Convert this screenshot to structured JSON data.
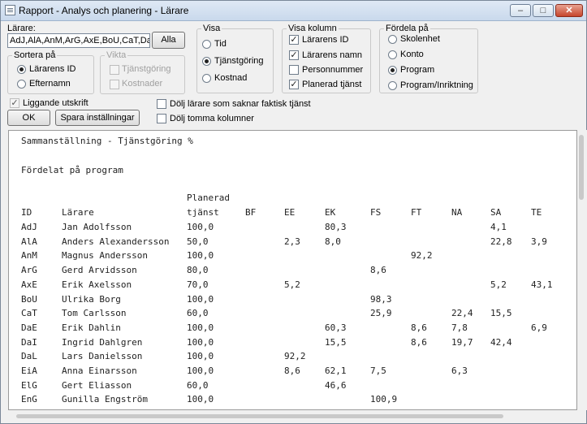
{
  "window": {
    "title": "Rapport - Analys och planering - Lärare",
    "minimize_glyph": "–",
    "maximize_glyph": "□",
    "close_glyph": "✕"
  },
  "larare": {
    "label": "Lärare:",
    "value": "AdJ,AlA,AnM,ArG,AxE,BoU,CaT,DaE,Da",
    "all_button": "Alla"
  },
  "sortera": {
    "title": "Sortera på",
    "options": [
      {
        "label": "Lärarens ID",
        "selected": true
      },
      {
        "label": "Efternamn",
        "selected": false
      }
    ]
  },
  "vikta": {
    "title": "Vikta",
    "options": [
      {
        "label": "Tjänstgöring",
        "checked": false
      },
      {
        "label": "Kostnader",
        "checked": false
      }
    ]
  },
  "visa": {
    "title": "Visa",
    "options": [
      {
        "label": "Tid",
        "selected": false
      },
      {
        "label": "Tjänstgöring",
        "selected": true
      },
      {
        "label": "Kostnad",
        "selected": false
      }
    ]
  },
  "visa_kolumn": {
    "title": "Visa kolumn",
    "options": [
      {
        "label": "Lärarens ID",
        "checked": true
      },
      {
        "label": "Lärarens namn",
        "checked": true
      },
      {
        "label": "Personnummer",
        "checked": false
      },
      {
        "label": "Planerad tjänst",
        "checked": true
      }
    ]
  },
  "fordela": {
    "title": "Fördela på",
    "options": [
      {
        "label": "Skolenhet",
        "selected": false
      },
      {
        "label": "Konto",
        "selected": false
      },
      {
        "label": "Program",
        "selected": true
      },
      {
        "label": "Program/Inriktning",
        "selected": false
      }
    ]
  },
  "options": {
    "liggande": {
      "label": "Liggande utskrift",
      "checked": true
    },
    "dolj_larare": {
      "label": "Dölj lärare som saknar faktisk tjänst",
      "checked": false
    },
    "dolj_tomma": {
      "label": "Dölj tomma kolumner",
      "checked": false
    }
  },
  "buttons": {
    "ok": "OK",
    "save": "Spara inställningar"
  },
  "report": {
    "title": "Sammanställning - Tjänstgöring %",
    "subtitle": "Fördelat på program",
    "header_top": "Planerad",
    "columns": [
      "ID",
      "Lärare",
      "tjänst",
      "BF",
      "EE",
      "EK",
      "FS",
      "FT",
      "NA",
      "SA",
      "TE"
    ],
    "rows": [
      [
        "AdJ",
        "Jan Adolfsson",
        "100,0",
        "",
        "",
        "80,3",
        "",
        "",
        "",
        "4,1",
        ""
      ],
      [
        "AlA",
        "Anders Alexandersson",
        "50,0",
        "",
        "2,3",
        "8,0",
        "",
        "",
        "",
        "22,8",
        "3,9"
      ],
      [
        "AnM",
        "Magnus Andersson",
        "100,0",
        "",
        "",
        "",
        "",
        "92,2",
        "",
        "",
        ""
      ],
      [
        "ArG",
        "Gerd Arvidsson",
        "80,0",
        "",
        "",
        "",
        "8,6",
        "",
        "",
        "",
        ""
      ],
      [
        "AxE",
        "Erik Axelsson",
        "70,0",
        "",
        "5,2",
        "",
        "",
        "",
        "",
        "5,2",
        "43,1"
      ],
      [
        "BoU",
        "Ulrika Borg",
        "100,0",
        "",
        "",
        "",
        "98,3",
        "",
        "",
        "",
        ""
      ],
      [
        "CaT",
        "Tom Carlsson",
        "60,0",
        "",
        "",
        "",
        "25,9",
        "",
        "22,4",
        "15,5",
        ""
      ],
      [
        "DaE",
        "Erik Dahlin",
        "100,0",
        "",
        "",
        "60,3",
        "",
        "8,6",
        "7,8",
        "",
        "6,9"
      ],
      [
        "DaI",
        "Ingrid Dahlgren",
        "100,0",
        "",
        "",
        "15,5",
        "",
        "8,6",
        "19,7",
        "42,4",
        ""
      ],
      [
        "DaL",
        "Lars Danielsson",
        "100,0",
        "",
        "92,2",
        "",
        "",
        "",
        "",
        "",
        ""
      ],
      [
        "EiA",
        "Anna Einarsson",
        "100,0",
        "",
        "8,6",
        "62,1",
        "7,5",
        "",
        "6,3",
        "",
        ""
      ],
      [
        "ElG",
        "Gert Eliasson",
        "60,0",
        "",
        "",
        "46,6",
        "",
        "",
        "",
        "",
        ""
      ],
      [
        "EnG",
        "Gunilla Engström",
        "100,0",
        "",
        "",
        "",
        "100,9",
        "",
        "",
        "",
        ""
      ]
    ]
  }
}
